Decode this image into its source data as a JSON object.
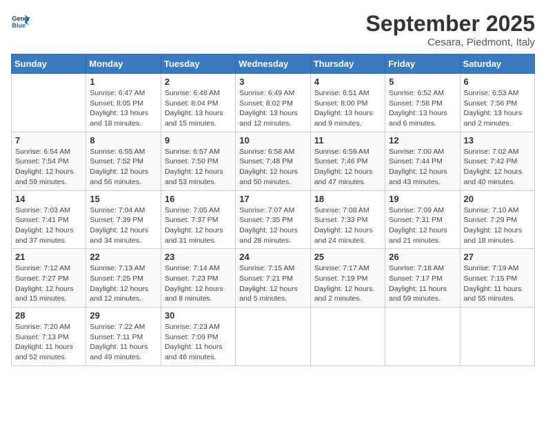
{
  "header": {
    "logo_general": "General",
    "logo_blue": "Blue",
    "month_year": "September 2025",
    "location": "Cesara, Piedmont, Italy"
  },
  "days_of_week": [
    "Sunday",
    "Monday",
    "Tuesday",
    "Wednesday",
    "Thursday",
    "Friday",
    "Saturday"
  ],
  "weeks": [
    [
      {
        "day": "",
        "sunrise": "",
        "sunset": "",
        "daylight": ""
      },
      {
        "day": "1",
        "sunrise": "Sunrise: 6:47 AM",
        "sunset": "Sunset: 8:05 PM",
        "daylight": "Daylight: 13 hours and 18 minutes."
      },
      {
        "day": "2",
        "sunrise": "Sunrise: 6:48 AM",
        "sunset": "Sunset: 8:04 PM",
        "daylight": "Daylight: 13 hours and 15 minutes."
      },
      {
        "day": "3",
        "sunrise": "Sunrise: 6:49 AM",
        "sunset": "Sunset: 8:02 PM",
        "daylight": "Daylight: 13 hours and 12 minutes."
      },
      {
        "day": "4",
        "sunrise": "Sunrise: 6:51 AM",
        "sunset": "Sunset: 8:00 PM",
        "daylight": "Daylight: 13 hours and 9 minutes."
      },
      {
        "day": "5",
        "sunrise": "Sunrise: 6:52 AM",
        "sunset": "Sunset: 7:58 PM",
        "daylight": "Daylight: 13 hours and 6 minutes."
      },
      {
        "day": "6",
        "sunrise": "Sunrise: 6:53 AM",
        "sunset": "Sunset: 7:56 PM",
        "daylight": "Daylight: 13 hours and 2 minutes."
      }
    ],
    [
      {
        "day": "7",
        "sunrise": "Sunrise: 6:54 AM",
        "sunset": "Sunset: 7:54 PM",
        "daylight": "Daylight: 12 hours and 59 minutes."
      },
      {
        "day": "8",
        "sunrise": "Sunrise: 6:55 AM",
        "sunset": "Sunset: 7:52 PM",
        "daylight": "Daylight: 12 hours and 56 minutes."
      },
      {
        "day": "9",
        "sunrise": "Sunrise: 6:57 AM",
        "sunset": "Sunset: 7:50 PM",
        "daylight": "Daylight: 12 hours and 53 minutes."
      },
      {
        "day": "10",
        "sunrise": "Sunrise: 6:58 AM",
        "sunset": "Sunset: 7:48 PM",
        "daylight": "Daylight: 12 hours and 50 minutes."
      },
      {
        "day": "11",
        "sunrise": "Sunrise: 6:59 AM",
        "sunset": "Sunset: 7:46 PM",
        "daylight": "Daylight: 12 hours and 47 minutes."
      },
      {
        "day": "12",
        "sunrise": "Sunrise: 7:00 AM",
        "sunset": "Sunset: 7:44 PM",
        "daylight": "Daylight: 12 hours and 43 minutes."
      },
      {
        "day": "13",
        "sunrise": "Sunrise: 7:02 AM",
        "sunset": "Sunset: 7:42 PM",
        "daylight": "Daylight: 12 hours and 40 minutes."
      }
    ],
    [
      {
        "day": "14",
        "sunrise": "Sunrise: 7:03 AM",
        "sunset": "Sunset: 7:41 PM",
        "daylight": "Daylight: 12 hours and 37 minutes."
      },
      {
        "day": "15",
        "sunrise": "Sunrise: 7:04 AM",
        "sunset": "Sunset: 7:39 PM",
        "daylight": "Daylight: 12 hours and 34 minutes."
      },
      {
        "day": "16",
        "sunrise": "Sunrise: 7:05 AM",
        "sunset": "Sunset: 7:37 PM",
        "daylight": "Daylight: 12 hours and 31 minutes."
      },
      {
        "day": "17",
        "sunrise": "Sunrise: 7:07 AM",
        "sunset": "Sunset: 7:35 PM",
        "daylight": "Daylight: 12 hours and 28 minutes."
      },
      {
        "day": "18",
        "sunrise": "Sunrise: 7:08 AM",
        "sunset": "Sunset: 7:33 PM",
        "daylight": "Daylight: 12 hours and 24 minutes."
      },
      {
        "day": "19",
        "sunrise": "Sunrise: 7:09 AM",
        "sunset": "Sunset: 7:31 PM",
        "daylight": "Daylight: 12 hours and 21 minutes."
      },
      {
        "day": "20",
        "sunrise": "Sunrise: 7:10 AM",
        "sunset": "Sunset: 7:29 PM",
        "daylight": "Daylight: 12 hours and 18 minutes."
      }
    ],
    [
      {
        "day": "21",
        "sunrise": "Sunrise: 7:12 AM",
        "sunset": "Sunset: 7:27 PM",
        "daylight": "Daylight: 12 hours and 15 minutes."
      },
      {
        "day": "22",
        "sunrise": "Sunrise: 7:13 AM",
        "sunset": "Sunset: 7:25 PM",
        "daylight": "Daylight: 12 hours and 12 minutes."
      },
      {
        "day": "23",
        "sunrise": "Sunrise: 7:14 AM",
        "sunset": "Sunset: 7:23 PM",
        "daylight": "Daylight: 12 hours and 8 minutes."
      },
      {
        "day": "24",
        "sunrise": "Sunrise: 7:15 AM",
        "sunset": "Sunset: 7:21 PM",
        "daylight": "Daylight: 12 hours and 5 minutes."
      },
      {
        "day": "25",
        "sunrise": "Sunrise: 7:17 AM",
        "sunset": "Sunset: 7:19 PM",
        "daylight": "Daylight: 12 hours and 2 minutes."
      },
      {
        "day": "26",
        "sunrise": "Sunrise: 7:18 AM",
        "sunset": "Sunset: 7:17 PM",
        "daylight": "Daylight: 11 hours and 59 minutes."
      },
      {
        "day": "27",
        "sunrise": "Sunrise: 7:19 AM",
        "sunset": "Sunset: 7:15 PM",
        "daylight": "Daylight: 11 hours and 55 minutes."
      }
    ],
    [
      {
        "day": "28",
        "sunrise": "Sunrise: 7:20 AM",
        "sunset": "Sunset: 7:13 PM",
        "daylight": "Daylight: 11 hours and 52 minutes."
      },
      {
        "day": "29",
        "sunrise": "Sunrise: 7:22 AM",
        "sunset": "Sunset: 7:11 PM",
        "daylight": "Daylight: 11 hours and 49 minutes."
      },
      {
        "day": "30",
        "sunrise": "Sunrise: 7:23 AM",
        "sunset": "Sunset: 7:09 PM",
        "daylight": "Daylight: 11 hours and 46 minutes."
      },
      {
        "day": "",
        "sunrise": "",
        "sunset": "",
        "daylight": ""
      },
      {
        "day": "",
        "sunrise": "",
        "sunset": "",
        "daylight": ""
      },
      {
        "day": "",
        "sunrise": "",
        "sunset": "",
        "daylight": ""
      },
      {
        "day": "",
        "sunrise": "",
        "sunset": "",
        "daylight": ""
      }
    ]
  ]
}
